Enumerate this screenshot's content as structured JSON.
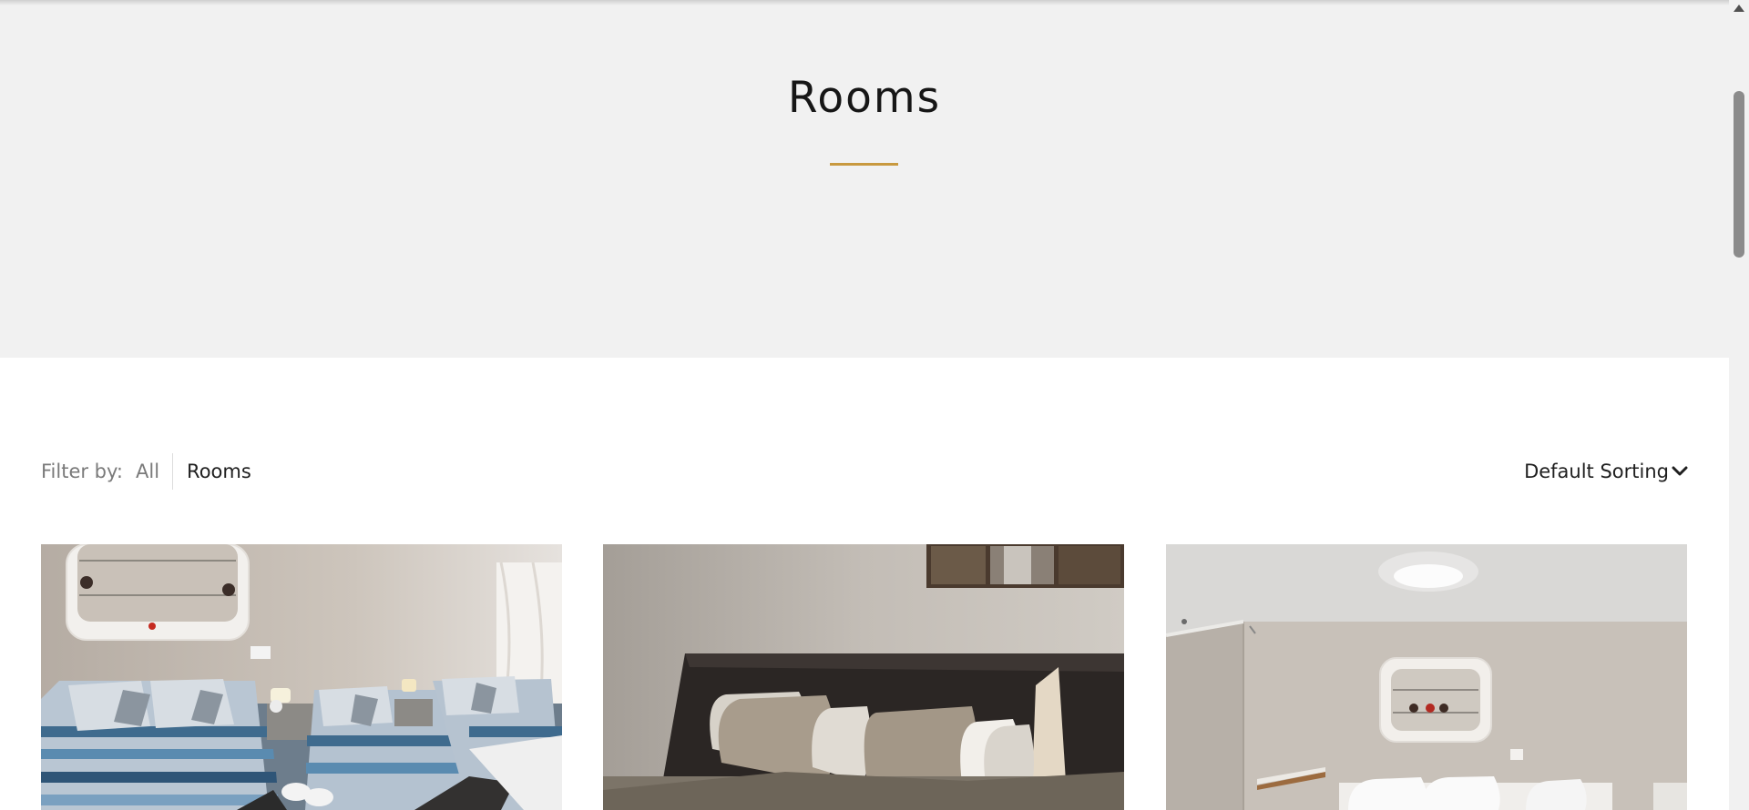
{
  "hero": {
    "title": "Rooms",
    "accent_color": "#c8993f",
    "background": "#f1f1f1"
  },
  "filter": {
    "label": "Filter by:",
    "options": [
      {
        "label": "All",
        "active": false
      },
      {
        "label": "Rooms",
        "active": true
      }
    ]
  },
  "sorting": {
    "label": "Default Sorting",
    "icon": "chevron-down-icon"
  },
  "rooms": [
    {
      "image": "room-photo-twin-beds"
    },
    {
      "image": "room-photo-double-bed"
    },
    {
      "image": "room-photo-bright-room"
    }
  ],
  "scrollbar": {
    "up_icon": "triangle-up-icon"
  }
}
